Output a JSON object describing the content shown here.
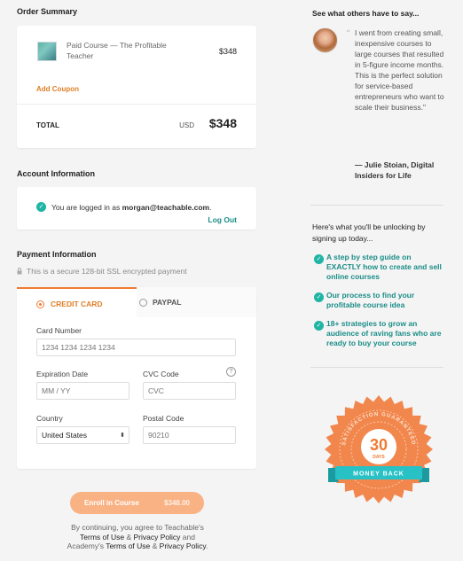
{
  "order_summary": {
    "title": "Order Summary",
    "product_name": "Paid Course — The Profitable Teacher",
    "product_price": "$348",
    "add_coupon": "Add Coupon",
    "total_label": "TOTAL",
    "currency": "USD",
    "total_amount": "$348"
  },
  "account": {
    "title": "Account Information",
    "logged_in_prefix": "You are logged in as ",
    "email": "morgan@teachable.com",
    "logged_in_suffix": ".",
    "logout": "Log Out"
  },
  "payment": {
    "title": "Payment Information",
    "secure_text": "This is a secure 128-bit SSL encrypted payment",
    "tabs": [
      {
        "label": "CREDIT CARD",
        "selected": true
      },
      {
        "label": "PAYPAL",
        "selected": false
      }
    ],
    "card_number_label": "Card Number",
    "card_number_placeholder": "1234 1234 1234 1234",
    "expiration_label": "Expiration Date",
    "expiration_placeholder": "MM / YY",
    "cvc_label": "CVC Code",
    "cvc_placeholder": "CVC",
    "cvc_help": "?",
    "country_label": "Country",
    "country_value": "United States",
    "postal_label": "Postal Code",
    "postal_placeholder": "90210"
  },
  "enroll": {
    "label": "Enroll in Course",
    "amount": "$348.00"
  },
  "agreement": {
    "line1": "By continuing, you agree to Teachable's",
    "terms1": "Terms of Use",
    "amp1": " & ",
    "privacy1": "Privacy Policy",
    "and": " and",
    "academy": "Academy's ",
    "terms2": "Terms of Use",
    "amp2": " & ",
    "privacy2": "Privacy Policy",
    "end": "."
  },
  "testimonial": {
    "title": "See what others have to say...",
    "quote": "I went from creating small, inexpensive courses to large courses that resulted in 5-figure income months. This is the perfect solution for service-based entrepreneurs who want to scale their business.\"",
    "author": "— Julie Stoian, Digital Insiders for Life"
  },
  "unlocking": {
    "title": "Here's what you'll be unlocking by signing up today...",
    "benefits": [
      "A step by step guide on EXACTLY how to create and sell online courses",
      "Our process to find your profitable course idea",
      "18+ strategies to grow an audience of raving fans who are ready to buy your course"
    ]
  },
  "badge": {
    "arc_text": "SATISFACTION GUARANTEED",
    "number": "30",
    "days": "DAYS",
    "ribbon": "MONEY BACK"
  },
  "colors": {
    "accent_orange": "#f07a32",
    "teal": "#1fb5a4",
    "badge_orange": "#f2874e",
    "ribbon_teal": "#27c1c6"
  }
}
